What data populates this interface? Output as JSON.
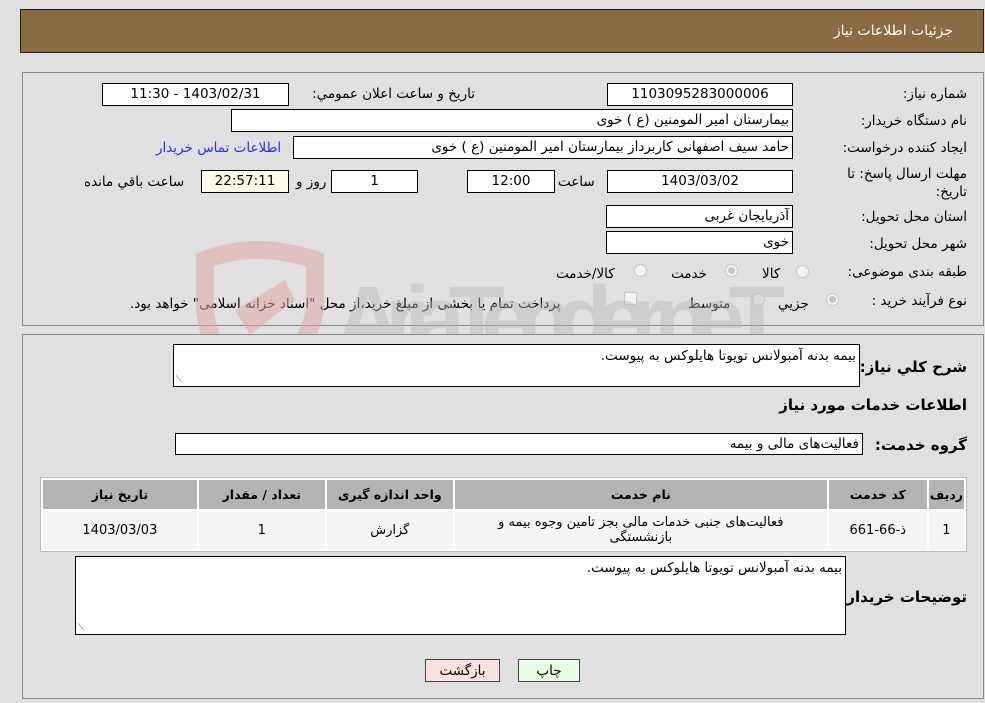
{
  "header": {
    "title": "جزئيات اطلاعات نیاز"
  },
  "details": {
    "need_number_label": "شماره نیاز:",
    "need_number": "1103095283000006",
    "announce_label": "تاریخ و ساعت اعلان عمومي:",
    "announce_value": "1403/02/31 - 11:30",
    "buyer_org_label": "نام دستگاه خریدار:",
    "buyer_org": "بیمارستان امیر المومنین (ع ) خوی",
    "creator_label": "ایجاد کننده درخواست:",
    "creator": "حامد سیف اصفهانی کاربرداز بیمارستان امیر المومنین (ع ) خوی",
    "contact_link": "اطلاعات تماس خریدار",
    "deadline_label": "مهلت ارسال پاسخ: تا تاریخ:",
    "deadline_date": "1403/03/02",
    "time_label": "ساعت",
    "deadline_time": "12:00",
    "days_value": "1",
    "days_label": "روز و",
    "remaining_time": "22:57:11",
    "remaining_label": "ساعت باقي مانده",
    "province_label": "استان محل تحویل:",
    "province": "آذربایجان غربی",
    "city_label": "شهر محل تحویل:",
    "city": "خوی",
    "category_label": "طبقه بندی موضوعی:",
    "category_options": [
      {
        "label": "کالا",
        "selected": false
      },
      {
        "label": "خدمت",
        "selected": true
      },
      {
        "label": "کالا/خدمت",
        "selected": false
      }
    ],
    "process_label": "نوع فرآیند خرید :",
    "process_options": [
      {
        "label": "جزيي",
        "selected": true
      },
      {
        "label": "متوسط",
        "selected": false
      }
    ],
    "treasury_note": "پرداخت تمام یا بخشی از مبلغ خرید،از محل \"اسناد خزانه اسلامی\" خواهد بود."
  },
  "services": {
    "description_label": "شرح کلي نياز:",
    "description": "بیمه بدنه آمبولانس تویوتا هایلوکس به پیوست.",
    "section_title": "اطلاعات خدمات مورد نياز",
    "group_label": "گروه خدمت:",
    "group_value": "فعالیت‌های مالی و بیمه",
    "table": {
      "headers": [
        "ردیف",
        "کد خدمت",
        "نام خدمت",
        "واحد اندازه گیری",
        "تعداد / مقدار",
        "تاریخ نیاز"
      ],
      "rows": [
        [
          "1",
          "ذ-66-661",
          "فعالیت‌های جنبی خدمات مالی بجز تامین وجوه بیمه و بازنشستگی",
          "گزارش",
          "1",
          "1403/03/03"
        ]
      ]
    },
    "buyer_notes_label": "توضیحات خریدار:",
    "buyer_notes": "بیمه بدنه آمبولانس تویوتا هایلوکس به پیوست."
  },
  "buttons": {
    "print": "چاپ",
    "back": "بازگشت"
  },
  "watermark": {
    "text": "AriaTender.neT"
  }
}
